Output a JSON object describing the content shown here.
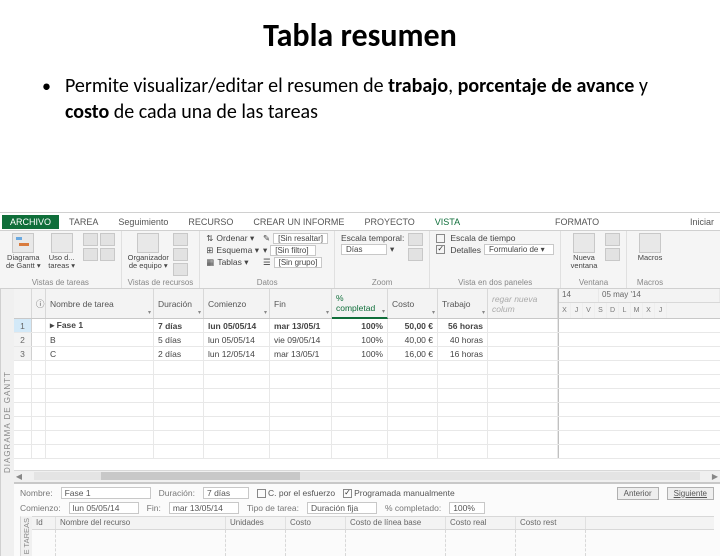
{
  "slide": {
    "title": "Tabla resumen",
    "bullet_html": "Permite visualizar/editar el resumen de <b>trabajo</b>, <b>porcentaje de avance</b> y <b>costo</b> de cada una de las tareas"
  },
  "ribbon": {
    "file": "ARCHIVO",
    "tabs": [
      "TAREA",
      "Seguimiento",
      "RECURSO",
      "CREAR UN INFORME",
      "PROYECTO",
      "VISTA",
      "FORMATO"
    ],
    "active_tab": "VISTA",
    "right": "Iniciar",
    "groups": {
      "vistas_tareas": {
        "label": "Vistas de tareas",
        "btn1_l1": "Diagrama",
        "btn1_l2": "de Gantt ▾",
        "btn2_l1": "Uso d...",
        "btn2_l2": "tareas ▾"
      },
      "vistas_recursos": {
        "label": "Vistas de recursos",
        "btn1_l1": "Organizador",
        "btn1_l2": "de equipo ▾"
      },
      "datos": {
        "label": "Datos",
        "sort": "Ordenar ▾",
        "outline": "Esquema ▾",
        "tables": "Tablas ▾",
        "filter_lbl": "[Sin resaltar]",
        "filter2_lbl": "[Sin filtro]",
        "group_lbl": "[Sin grupo]"
      },
      "zoom": {
        "label": "Zoom",
        "scale_lbl": "Escala temporal:",
        "scale_val": "Días"
      },
      "vista_paneles": {
        "label": "Vista en dos paneles",
        "timeline": "Escala de tiempo",
        "details": "Detalles",
        "details_val": "Formulario de ▾"
      },
      "ventana": {
        "label": "Ventana",
        "btn_l1": "Nueva",
        "btn_l2": "ventana"
      },
      "macros": {
        "label": "Macros",
        "btn": "Macros"
      }
    }
  },
  "grid": {
    "side_label": "DIAGRAMA DE GANTT",
    "headers": {
      "name": "Nombre de tarea",
      "duration": "Duración",
      "start": "Comienzo",
      "finish": "Fin",
      "pct": "% completad",
      "cost": "Costo",
      "work": "Trabajo",
      "addcol": "regar nueva colum"
    },
    "timeline_weeks": [
      "14",
      "05 may '14"
    ],
    "timeline_days": [
      "X",
      "J",
      "V",
      "S",
      "D",
      "L",
      "M",
      "X",
      "J"
    ],
    "rows": [
      {
        "n": "1",
        "name": "▸ Fase 1",
        "dur": "7 días",
        "start": "lun 05/05/14",
        "fin": "mar 13/05/1",
        "pct": "100%",
        "cost": "50,00 €",
        "work": "56 horas",
        "bold": true
      },
      {
        "n": "2",
        "name": "B",
        "dur": "5 días",
        "start": "lun 05/05/14",
        "fin": "vie 09/05/14",
        "pct": "100%",
        "cost": "40,00 €",
        "work": "40 horas"
      },
      {
        "n": "3",
        "name": "C",
        "dur": "2 días",
        "start": "lun 12/05/14",
        "fin": "mar 13/05/1",
        "pct": "100%",
        "cost": "16,00 €",
        "work": "16 horas"
      }
    ]
  },
  "form": {
    "side_label": "E TAREAS",
    "name_lbl": "Nombre:",
    "name_val": "Fase 1",
    "dur_lbl": "Duración:",
    "dur_val": "7 días",
    "effort": "C. por el esfuerzo",
    "manual": "Programada manualmente",
    "prev": "Anterior",
    "next": "Siguiente",
    "start_lbl": "Comienzo:",
    "start_val": "lun 05/05/14",
    "fin_lbl": "Fin:",
    "fin_val": "mar 13/05/14",
    "type_lbl": "Tipo de tarea:",
    "type_val": "Duración fija",
    "pct_lbl": "% completado:",
    "pct_val": "100%",
    "sub_headers": [
      "Id",
      "Nombre del recurso",
      "Unidades",
      "Costo",
      "Costo de línea base",
      "Costo real",
      "Costo rest"
    ]
  }
}
